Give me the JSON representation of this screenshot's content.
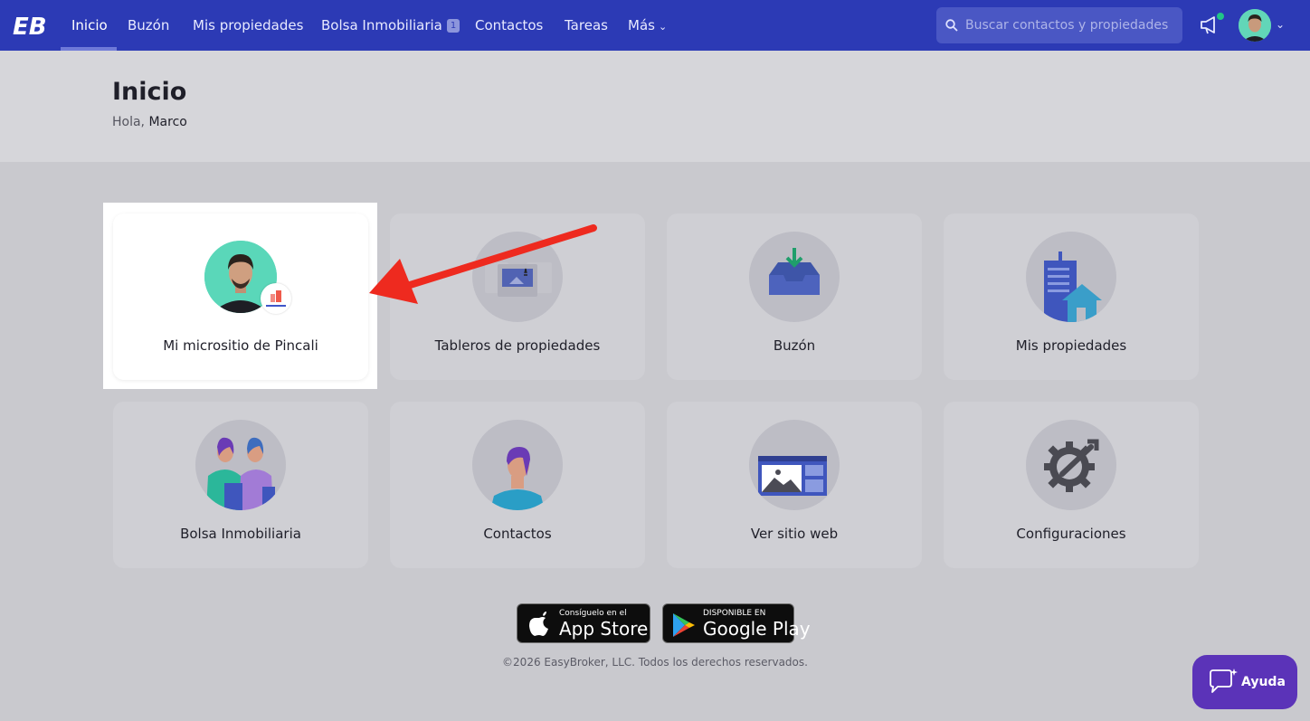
{
  "nav": {
    "logo_text": "EB",
    "items": [
      {
        "label": "Inicio"
      },
      {
        "label": "Buzón"
      },
      {
        "label": "Mis propiedades"
      },
      {
        "label": "Bolsa Inmobiliaria",
        "badge": "1"
      },
      {
        "label": "Contactos"
      },
      {
        "label": "Tareas"
      },
      {
        "label": "Más"
      }
    ],
    "search_placeholder": "Buscar contactos y propiedades"
  },
  "header": {
    "title": "Inicio",
    "greeting_prefix": "Hola,",
    "user_name": "Marco"
  },
  "cards": [
    {
      "label": "Mi micrositio de Pincali",
      "icon": "avatar"
    },
    {
      "label": "Tableros de propiedades",
      "icon": "board-icon"
    },
    {
      "label": "Buzón",
      "icon": "inbox-icon"
    },
    {
      "label": "Mis propiedades",
      "icon": "buildings-icon"
    },
    {
      "label": "Bolsa Inmobiliaria",
      "icon": "people-icon"
    },
    {
      "label": "Contactos",
      "icon": "contact-icon"
    },
    {
      "label": "Ver sitio web",
      "icon": "website-icon"
    },
    {
      "label": "Configuraciones",
      "icon": "gear-icon"
    }
  ],
  "stores": {
    "apple_small": "Consíguelo en el",
    "apple_big": "App Store",
    "google_small": "DISPONIBLE EN",
    "google_big": "Google Play"
  },
  "footer": "©2026 EasyBroker, LLC. Todos los derechos reservados.",
  "help_label": "Ayuda",
  "colors": {
    "nav_bg": "#2c3ab5",
    "help_bg": "#5b33b8",
    "annotation_arrow": "#ee2a1f"
  }
}
